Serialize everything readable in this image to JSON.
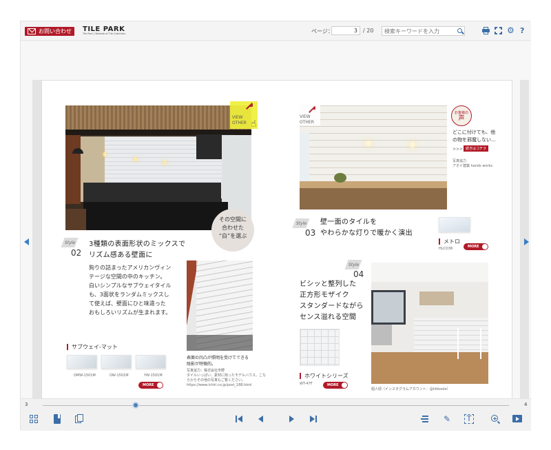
{
  "header": {
    "contact_label": "お問い合わせ",
    "logo_text": "TILE PARK",
    "logo_sub": "Tile Park | Website of Tile Collection",
    "page_label": "ページ：",
    "page_current": "3",
    "page_total": "/ 20",
    "search_placeholder": "検索キーワードを入力"
  },
  "left_page": {
    "view_other": "VIEW\nOTHER",
    "pill_text": "その空間に\n合わせた\n“白”を選ぶ",
    "style_tag": "Style",
    "style_num": "02",
    "heading": "3種類の表面形状のミックスで\nリズム感ある壁面に",
    "body": "狗りの詰まったアメリカンヴィン\nテージな空間の中のキッチン。\n白いシンプルなサブウェイタイル\nも、3面状をランダムミックスし\nて使えば、壁面にひと味違った\nおもしろいリズムが生まれます。",
    "photo_caption": "表面の凹凸が照明を受けてできる\n陰影が特徴的。",
    "photo_credit": "写真協力：株式会社市野\nタイルいっぱい、素材に拘ったモデルハウス。こち\nらからその他の写真もご覧ください。\nhttps://www.ichiri.co.jp/post_188.html",
    "product_label": "サブウェイ-マット",
    "products": [
      {
        "code": "OMW-1501M"
      },
      {
        "code": "OW-1501M"
      },
      {
        "code": "YW-1501M"
      }
    ],
    "more_label": "MORE"
  },
  "right_page": {
    "view_other": "VIEW\nOTHER",
    "voice_badge_top": "お客様の",
    "voice_badge_main": "声",
    "voice_text": "どこに付けても、他\nの物を邪魔しない…",
    "voice_more": ">>>",
    "voice_link": "続きはコチラ",
    "voice_credit": "写真協力\nアオイ建築 hands works",
    "style_tag_3": "Style",
    "style_num_3": "03",
    "heading_3": "壁一面のタイルを\nやわらかな灯りで暖かく演出",
    "product_label_3": "メトロ",
    "product_code_3": "HLCO36",
    "more_label_3": "MORE",
    "style_tag_4": "Style",
    "style_num_4": "04",
    "heading_4": "ビシッと整列した\n正方形モザイク\nスタンダードながら\nセンス溢れる空間",
    "product_label_4": "ホワイトシリーズ",
    "product_code_4": "WT-47F",
    "more_label_4": "MORE",
    "photo_credit_4": "個人邸（インスタグラムアカウント：@hitkoole）"
  },
  "footer": {
    "slider_start": "3",
    "slider_end": "4",
    "slider_position": 0.2
  },
  "colors": {
    "brand_red": "#b11a28",
    "accent_blue": "#3b6ea8",
    "view_other_yellow": "#efef3a"
  }
}
